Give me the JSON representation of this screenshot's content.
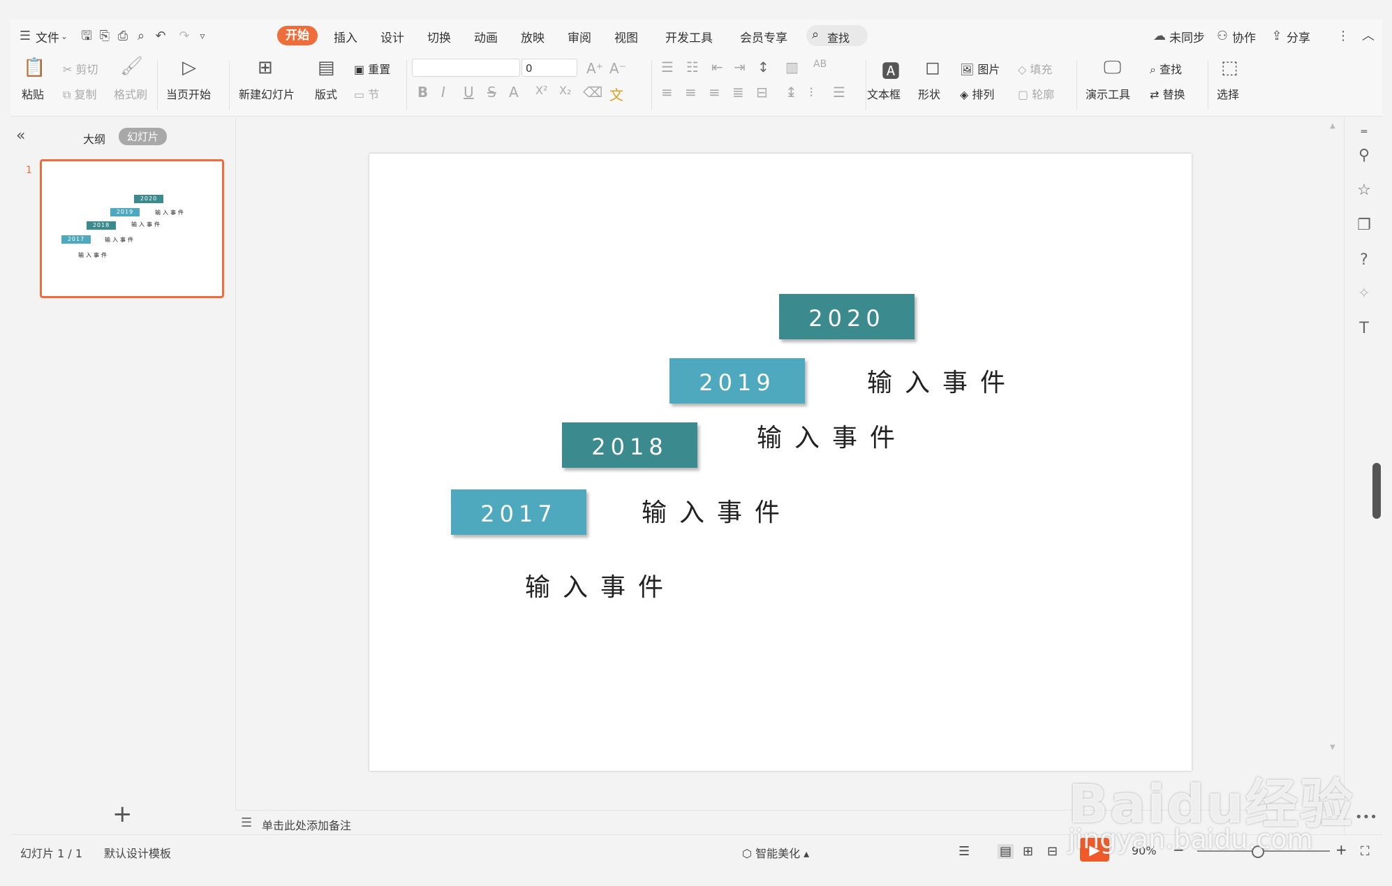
{
  "menubar": {
    "file": "文件",
    "tabs": [
      "开始",
      "插入",
      "设计",
      "切换",
      "动画",
      "放映",
      "审阅",
      "视图",
      "开发工具",
      "会员专享"
    ],
    "active_tab": "开始",
    "search": "查找",
    "right": [
      "未同步",
      "协作",
      "分享"
    ]
  },
  "ribbon": {
    "paste": "粘贴",
    "cut": "剪切",
    "copy": "复制",
    "format_painter": "格式刷",
    "play_from_current": "当页开始",
    "new_slide": "新建幻灯片",
    "layout": "版式",
    "reset": "重置",
    "section": "节",
    "font_name": "",
    "font_size": "0",
    "textbox": "文本框",
    "shape": "形状",
    "picture": "图片",
    "arrange": "排列",
    "fill": "填充",
    "outline": "轮廓",
    "presentation_tools": "演示工具",
    "find": "查找",
    "replace": "替换",
    "select": "选择"
  },
  "leftpanel": {
    "collapse": "«",
    "outline_tab": "大纲",
    "slides_tab": "幻灯片",
    "slide_number": "1",
    "add": "+"
  },
  "slide": {
    "years": [
      "2020",
      "2019",
      "2018",
      "2017"
    ],
    "event_text": "输入事件"
  },
  "notes": {
    "placeholder": "单击此处添加备注"
  },
  "statusbar": {
    "slide_index": "幻灯片 1 / 1",
    "template": "默认设计模板",
    "beautify": "智能美化",
    "zoom": "90%"
  },
  "watermark": {
    "line1": "Baidu经验",
    "line2": "jingyan.baidu.com"
  },
  "colors": {
    "accent": "#ee6d3a",
    "year_dark": "#3a8a8e",
    "year_light": "#4ea9bf"
  }
}
